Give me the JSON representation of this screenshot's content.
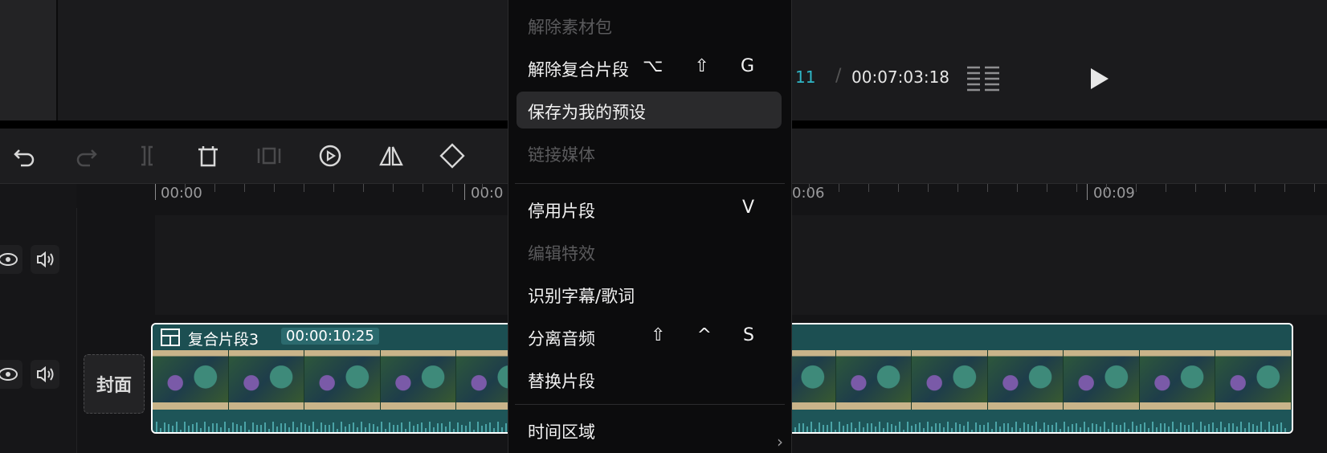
{
  "player": {
    "current_time_partial": "11",
    "separator": "/",
    "total_time": "00:07:03:18",
    "ratio_icon": "ratio-grid-icon",
    "play_icon": "play-icon"
  },
  "toolbar": {
    "icons": [
      "undo-icon",
      "redo-icon",
      "split-icon",
      "delete-icon",
      "freeze-icon",
      "reverse-play-icon",
      "mirror-icon",
      "rotate-icon"
    ]
  },
  "ruler": {
    "labels": [
      "00:00",
      "00:0",
      "0:06",
      "00:09"
    ]
  },
  "tracks": {
    "cover_label": "封面",
    "clip": {
      "name": "复合片段3",
      "duration": "00:00:10:25",
      "icon": "compound-clip-icon"
    }
  },
  "context_menu": {
    "items": [
      {
        "label": "解除素材包",
        "shortcut": "",
        "disabled": true
      },
      {
        "label": "解除复合片段",
        "shortcut": "⌥ ⇧ G",
        "disabled": false
      },
      {
        "label": "保存为我的预设",
        "shortcut": "",
        "disabled": false,
        "highlighted": true
      },
      {
        "label": "链接媒体",
        "shortcut": "",
        "disabled": true
      },
      {
        "label": "停用片段",
        "shortcut": "V",
        "disabled": false
      },
      {
        "label": "编辑特效",
        "shortcut": "",
        "disabled": true
      },
      {
        "label": "识别字幕/歌词",
        "shortcut": "",
        "disabled": false
      },
      {
        "label": "分离音频",
        "shortcut": "⇧ ^ S",
        "disabled": false
      },
      {
        "label": "替换片段",
        "shortcut": "",
        "disabled": false
      },
      {
        "label": "时间区域",
        "shortcut": "",
        "disabled": false
      }
    ]
  }
}
